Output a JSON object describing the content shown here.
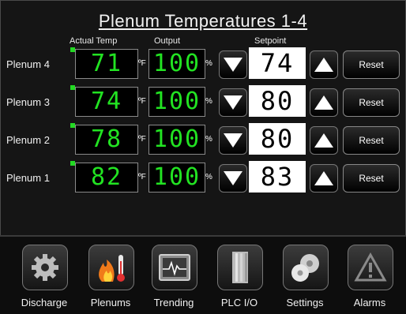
{
  "screen": {
    "title": "Plenum Temperatures 1-4",
    "columns": {
      "actual": "Actual Temp",
      "output": "Output",
      "setpoint": "Setpoint"
    }
  },
  "units": {
    "temp": "ºF",
    "percent": "%"
  },
  "rows": [
    {
      "label": "Plenum 4",
      "actual": "71",
      "output": "100",
      "setpoint": "74",
      "reset": "Reset"
    },
    {
      "label": "Plenum 3",
      "actual": "74",
      "output": "100",
      "setpoint": "80",
      "reset": "Reset"
    },
    {
      "label": "Plenum 2",
      "actual": "78",
      "output": "100",
      "setpoint": "80",
      "reset": "Reset"
    },
    {
      "label": "Plenum 1",
      "actual": "82",
      "output": "100",
      "setpoint": "83",
      "reset": "Reset"
    }
  ],
  "nav": [
    {
      "label": "Discharge",
      "icon": "gear-icon"
    },
    {
      "label": "Plenums",
      "icon": "flame-thermometer-icon"
    },
    {
      "label": "Trending",
      "icon": "trend-monitor-icon"
    },
    {
      "label": "PLC I/O",
      "icon": "plc-rack-icon"
    },
    {
      "label": "Settings",
      "icon": "settings-icon"
    },
    {
      "label": "Alarms",
      "icon": "warning-icon"
    }
  ],
  "colors": {
    "digits": "#22e322",
    "indicator": "#23d923",
    "background": "#151515"
  }
}
